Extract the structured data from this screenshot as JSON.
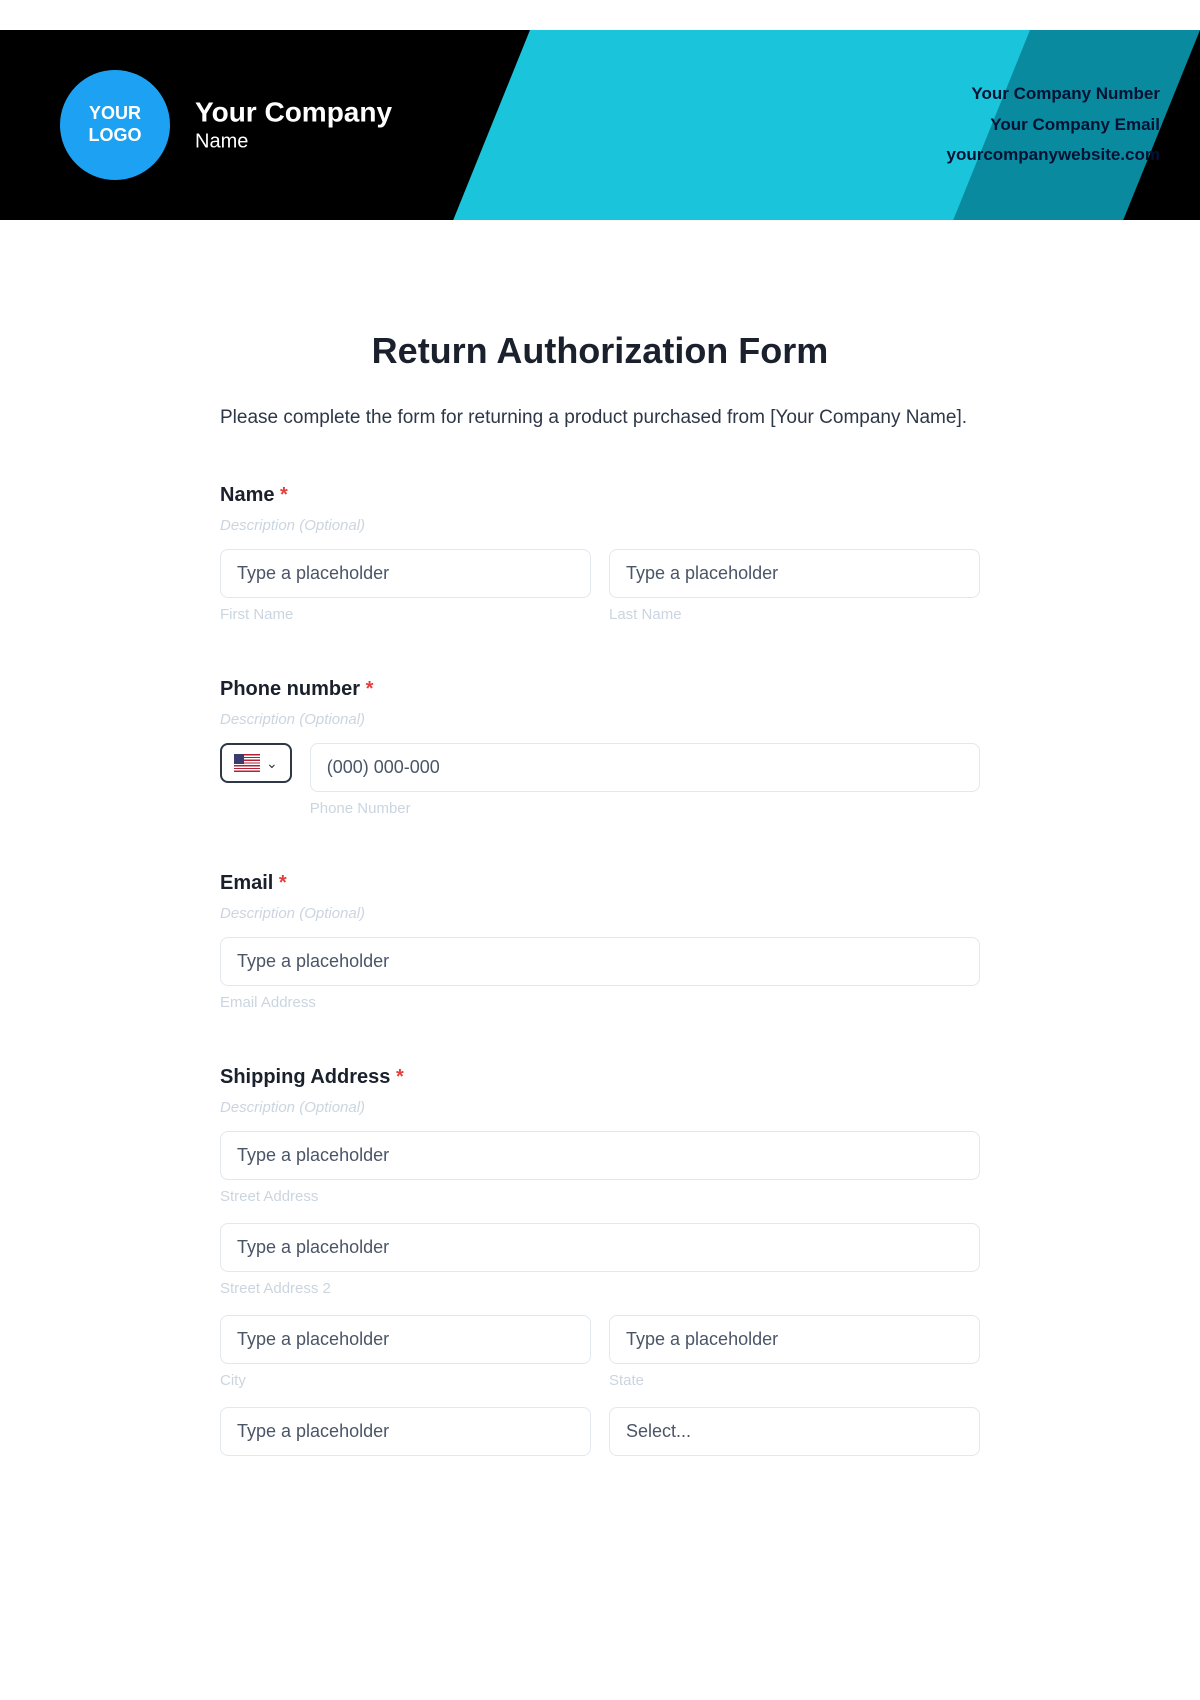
{
  "header": {
    "logo_line1": "YOUR",
    "logo_line2": "LOGO",
    "company_line1": "Your Company",
    "company_line2": "Name",
    "phone": "Your Company Number",
    "email": "Your Company Email",
    "website": "yourcompanywebsite.com"
  },
  "form": {
    "title": "Return Authorization Form",
    "description": "Please complete the form for returning a product purchased from [Your Company Name].",
    "hint_text": "Description (Optional)",
    "name": {
      "label": "Name",
      "first_placeholder": "Type a placeholder",
      "last_placeholder": "Type a placeholder",
      "first_sublabel": "First Name",
      "last_sublabel": "Last Name"
    },
    "phone": {
      "label": "Phone number",
      "placeholder": "(000) 000-000",
      "sublabel": "Phone Number"
    },
    "email": {
      "label": "Email",
      "placeholder": "Type a placeholder",
      "sublabel": "Email Address"
    },
    "address": {
      "label": "Shipping Address",
      "street1_placeholder": "Type a placeholder",
      "street1_sublabel": "Street Address",
      "street2_placeholder": "Type a placeholder",
      "street2_sublabel": "Street Address 2",
      "city_placeholder": "Type a placeholder",
      "city_sublabel": "City",
      "state_placeholder": "Type a placeholder",
      "state_sublabel": "State",
      "zip_placeholder": "Type a placeholder",
      "country_placeholder": "Select..."
    }
  }
}
